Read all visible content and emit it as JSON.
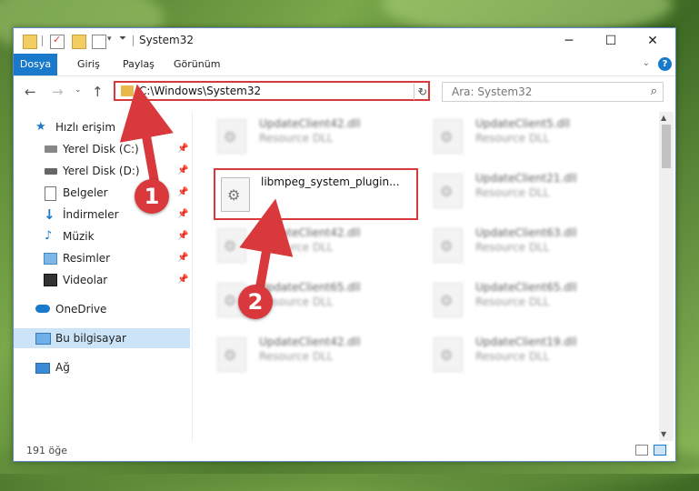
{
  "window": {
    "title": "System32",
    "controls": {
      "minimize": "─",
      "maximize": "☐",
      "close": "✕"
    }
  },
  "ribbon": {
    "tabs": [
      "Dosya",
      "Giriş",
      "Paylaş",
      "Görünüm"
    ],
    "help": "?"
  },
  "address": {
    "path": "C:\\Windows\\System32",
    "search_placeholder": "Ara: System32"
  },
  "sidebar": {
    "quick_access": "Hızlı erişim",
    "items": [
      {
        "label": "Yerel Disk (C:)",
        "icon": "drive-icon",
        "pinned": true
      },
      {
        "label": "Yerel Disk (D:)",
        "icon": "drive-icon",
        "pinned": true
      },
      {
        "label": "Belgeler",
        "icon": "documents-icon",
        "pinned": true
      },
      {
        "label": "İndirmeler",
        "icon": "downloads-icon",
        "pinned": true
      },
      {
        "label": "Müzik",
        "icon": "music-icon",
        "pinned": true
      },
      {
        "label": "Resimler",
        "icon": "pictures-icon",
        "pinned": true
      },
      {
        "label": "Videolar",
        "icon": "videos-icon",
        "pinned": true
      }
    ],
    "onedrive": "OneDrive",
    "this_pc": "Bu bilgisayar",
    "network": "Ağ"
  },
  "files": [
    {
      "name": "UpdateClient42.dll",
      "type": "Resource DLL"
    },
    {
      "name": "UpdateClient5.dll",
      "type": "Resource DLL"
    },
    {
      "name": "libmpeg_system_plugin...",
      "type": ""
    },
    {
      "name": "UpdateClient21.dll",
      "type": "Resource DLL"
    },
    {
      "name": "UpdateClient42.dll",
      "type": "Resource DLL"
    },
    {
      "name": "UpdateClient63.dll",
      "type": "Resource DLL"
    },
    {
      "name": "UpdateClient65.dll",
      "type": "Resource DLL"
    },
    {
      "name": "UpdateClient65.dll",
      "type": "Resource DLL"
    },
    {
      "name": "UpdateClient42.dll",
      "type": "Resource DLL"
    },
    {
      "name": "UpdateClient19.dll",
      "type": "Resource DLL"
    }
  ],
  "status": {
    "count": "191 öğe"
  },
  "annotations": {
    "step1": "1",
    "step2": "2"
  },
  "colors": {
    "accent": "#1979ca",
    "highlight": "#d9393c",
    "selected": "#cce4f7"
  }
}
